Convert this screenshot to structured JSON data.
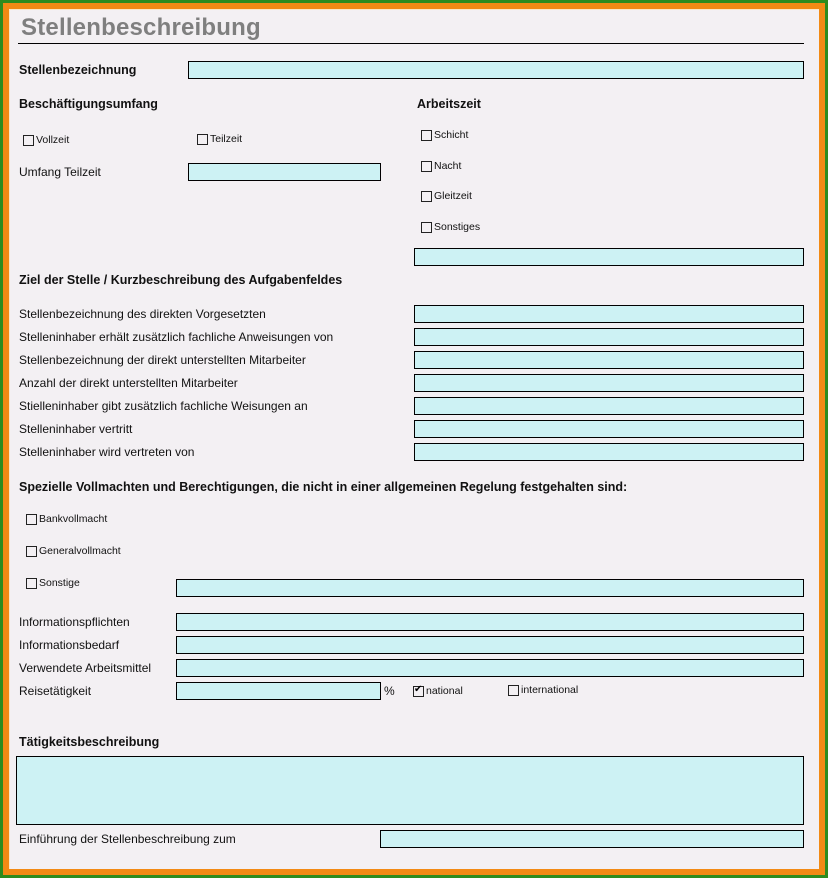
{
  "form": {
    "title": "Stellenbeschreibung",
    "job_title": {
      "label": "Stellenbezeichnung",
      "value": ""
    },
    "employment_scope": {
      "heading": "Beschäftigungsumfang",
      "options": [
        {
          "label": "Vollzeit",
          "checked": false
        },
        {
          "label": "Teilzeit",
          "checked": false
        }
      ],
      "part_time_label": "Umfang Teilzeit",
      "part_time_value": ""
    },
    "working_time": {
      "heading": "Arbeitszeit",
      "options": [
        {
          "label": "Schicht",
          "checked": false
        },
        {
          "label": "Nacht",
          "checked": false
        },
        {
          "label": "Gleitzeit",
          "checked": false
        },
        {
          "label": "Sonstiges",
          "checked": false
        }
      ],
      "other_value": ""
    },
    "goal_section": {
      "heading": "Ziel der Stelle / Kurzbeschreibung des Aufgabenfeldes",
      "rows": [
        {
          "label": "Stellenbezeichnung des direkten Vorgesetzten",
          "value": ""
        },
        {
          "label": "Stelleninhaber erhält zusätzlich fachliche Anweisungen von",
          "value": ""
        },
        {
          "label": "Stellenbezeichnung der direkt unterstellten Mitarbeiter",
          "value": ""
        },
        {
          "label": "Anzahl der direkt unterstellten Mitarbeiter",
          "value": ""
        },
        {
          "label": "Stielleninhaber gibt zusätzlich fachliche Weisungen an",
          "value": ""
        },
        {
          "label": "Stelleninhaber vertritt",
          "value": ""
        },
        {
          "label": "Stelleninhaber wird vertreten von",
          "value": ""
        }
      ]
    },
    "authority_section": {
      "heading": "Spezielle Vollmachten und Berechtigungen, die nicht in einer allgemeinen Regelung festgehalten sind:",
      "options": [
        {
          "label": "Bankvollmacht",
          "checked": false
        },
        {
          "label": "Generalvollmacht",
          "checked": false
        },
        {
          "label": "Sonstige",
          "checked": false
        }
      ],
      "other_value": ""
    },
    "info_rows": [
      {
        "label": "Informationspflichten",
        "value": ""
      },
      {
        "label": "Informationsbedarf",
        "value": ""
      },
      {
        "label": "Verwendete Arbeitsmittel",
        "value": ""
      }
    ],
    "travel": {
      "label": "Reisetätigkeit",
      "value": "",
      "unit": "%",
      "options": [
        {
          "label": "national",
          "checked": true
        },
        {
          "label": "international",
          "checked": false
        }
      ]
    },
    "activity": {
      "heading": "Tätigkeitsbeschreibung",
      "value": ""
    },
    "introduction": {
      "label": "Einführung der Stellenbeschreibung zum",
      "value": ""
    }
  },
  "colors": {
    "outer_border": "#2e8b1e",
    "inner_border": "#f28a14",
    "background": "#f3f0f3",
    "field_fill": "#cdf2f4",
    "title_text": "#7f7f7f"
  }
}
